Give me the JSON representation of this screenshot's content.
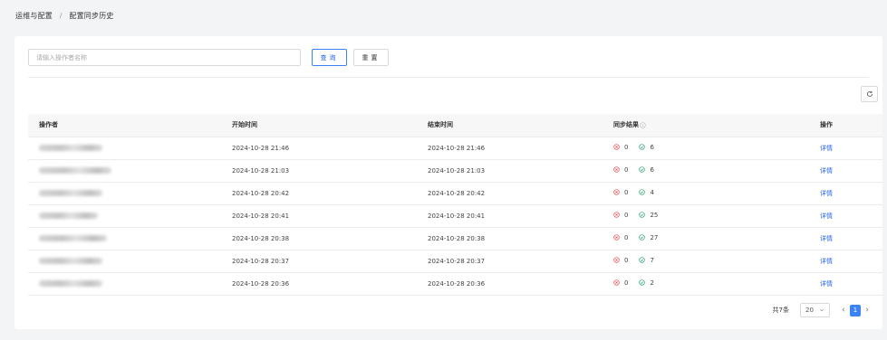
{
  "breadcrumb": {
    "parent": "运维与配置",
    "separator": "/",
    "current": "配置同步历史"
  },
  "search": {
    "placeholder": "请输入操作者名称",
    "value": ""
  },
  "buttons": {
    "query": "查询",
    "reset": "重置"
  },
  "table": {
    "headers": {
      "operator": "操作者",
      "start_time": "开始时间",
      "end_time": "结束时间",
      "sync_result": "同步结果",
      "action": "操作"
    },
    "rows": [
      {
        "operator": "",
        "start": "2024-10-28 21:46",
        "end": "2024-10-28 21:46",
        "failed": "0",
        "success": "6",
        "action": "详情"
      },
      {
        "operator": "",
        "start": "2024-10-28 21:03",
        "end": "2024-10-28 21:03",
        "failed": "0",
        "success": "6",
        "action": "详情"
      },
      {
        "operator": "",
        "start": "2024-10-28 20:42",
        "end": "2024-10-28 20:42",
        "failed": "0",
        "success": "4",
        "action": "详情"
      },
      {
        "operator": "",
        "start": "2024-10-28 20:41",
        "end": "2024-10-28 20:41",
        "failed": "0",
        "success": "25",
        "action": "详情"
      },
      {
        "operator": "",
        "start": "2024-10-28 20:38",
        "end": "2024-10-28 20:38",
        "failed": "0",
        "success": "27",
        "action": "详情"
      },
      {
        "operator": "",
        "start": "2024-10-28 20:37",
        "end": "2024-10-28 20:37",
        "failed": "0",
        "success": "7",
        "action": "详情"
      },
      {
        "operator": "",
        "start": "2024-10-28 20:36",
        "end": "2024-10-28 20:36",
        "failed": "0",
        "success": "2",
        "action": "详情"
      }
    ]
  },
  "pagination": {
    "total_label": "共7条",
    "page_size": "20",
    "current_page": "1"
  },
  "colors": {
    "primary": "#3b82f6",
    "fail": "#e5484d",
    "success": "#22a06b",
    "link": "#2563eb"
  },
  "icons": {
    "refresh": "refresh-icon",
    "info": "info-circle-icon",
    "fail": "x-circle-icon",
    "success": "check-circle-icon"
  }
}
